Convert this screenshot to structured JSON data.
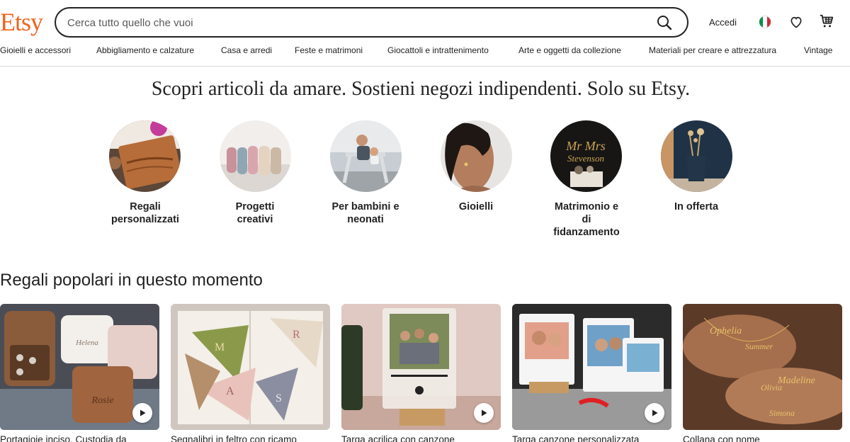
{
  "header": {
    "logo": "Etsy",
    "search_placeholder": "Cerca tutto quello che vuoi",
    "signin_label": "Accedi",
    "icons": [
      "search-icon",
      "italy-flag-icon",
      "heart-icon",
      "cart-icon"
    ]
  },
  "nav": {
    "categories": [
      "Gioielli e accessori",
      "Abbigliamento e calzature",
      "Casa e arredi",
      "Feste e matrimoni",
      "Giocattoli e intrattenimento",
      "Arte e oggetti da collezione",
      "Materiali per creare e attrezzatura",
      "Vintage"
    ]
  },
  "hero": {
    "title": "Scopri articoli da amare. Sostieni negozi indipendenti. Solo su Etsy.",
    "circles": [
      {
        "line1": "Regali",
        "line2": "personalizzati",
        "line3": ""
      },
      {
        "line1": "Progetti",
        "line2": "creativi",
        "line3": ""
      },
      {
        "line1": "Per bambini e",
        "line2": "neonati",
        "line3": ""
      },
      {
        "line1": "Gioielli",
        "line2": "",
        "line3": ""
      },
      {
        "line1": "Matrimonio e",
        "line2": "di",
        "line3": "fidanzamento"
      },
      {
        "line1": "In offerta",
        "line2": "",
        "line3": ""
      }
    ]
  },
  "popular": {
    "title": "Regali popolari in questo momento",
    "cards": [
      {
        "title": "Portagioie inciso, Custodia da",
        "has_video": true
      },
      {
        "title": "Segnalibri in feltro con ricamo",
        "has_video": false
      },
      {
        "title": "Targa acrilica con canzone",
        "has_video": true
      },
      {
        "title": "Targa canzone personalizzata",
        "has_video": true
      },
      {
        "title": "Collana con nome",
        "has_video": false
      }
    ]
  },
  "colors": {
    "brand": "#F1641E",
    "text": "#222222",
    "flag_green": "#009246",
    "flag_white": "#FFFFFF",
    "flag_red": "#CE2B37"
  }
}
